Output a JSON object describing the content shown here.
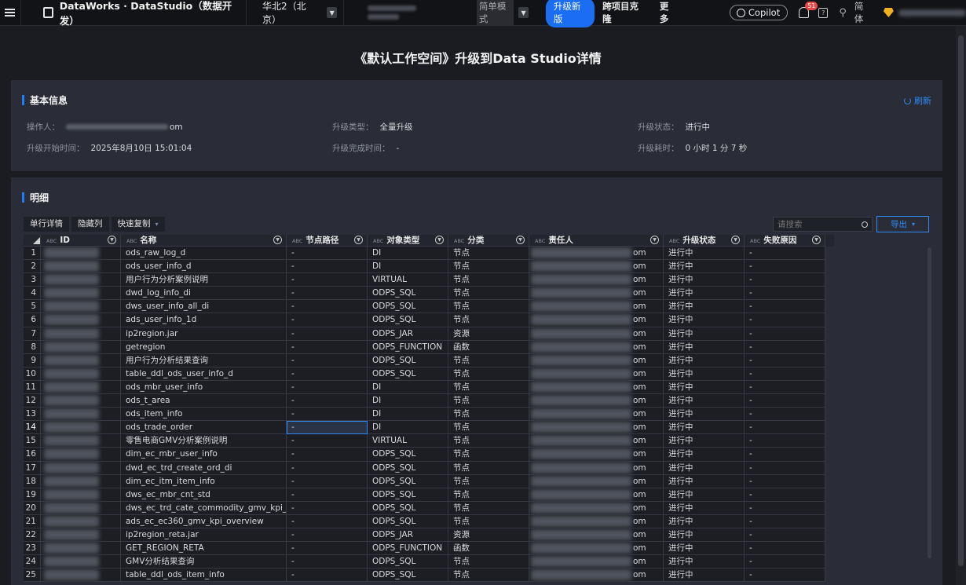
{
  "topbar": {
    "brand": "DataWorks · DataStudio（数据开发）",
    "region": "华北2（北京）",
    "mode": "简单模式",
    "upgrade_btn": "升级新版",
    "clone_link": "跨项目克隆",
    "more_link": "更多",
    "copilot": "Copilot",
    "notifications": "51",
    "help": "?",
    "lang": "简体"
  },
  "page_title": "《默认工作空间》升级到Data Studio详情",
  "basic_info": {
    "section_title": "基本信息",
    "refresh_label": "刷新",
    "operator_label": "操作人：",
    "operator_suffix": "om",
    "upgrade_type_label": "升级类型：",
    "upgrade_type_value": "全量升级",
    "upgrade_status_label": "升级状态：",
    "upgrade_status_value": "进行中",
    "start_time_label": "升级开始时间：",
    "start_time_value": "2025年8月10日 15:01:04",
    "finish_time_label": "升级完成时间：",
    "finish_time_value": "-",
    "duration_label": "升级耗时：",
    "duration_value": "0 小时 1 分 7 秒"
  },
  "detail": {
    "section_title": "明细",
    "btn_row_detail": "单行详情",
    "btn_hide_cols": "隐藏列",
    "btn_quick_copy": "快速复制",
    "search_placeholder": "请搜索",
    "export_label": "导出",
    "columns": [
      "ID",
      "名称",
      "节点路径",
      "对象类型",
      "分类",
      "责任人",
      "升级状态",
      "失败原因"
    ],
    "rows": [
      {
        "n": "1",
        "name": "ods_raw_log_d",
        "path": "-",
        "type": "DI",
        "cat": "节点",
        "owner_suffix": "om",
        "status": "进行中",
        "reason": "-"
      },
      {
        "n": "2",
        "name": "ods_user_info_d",
        "path": "-",
        "type": "DI",
        "cat": "节点",
        "owner_suffix": "om",
        "status": "进行中",
        "reason": "-"
      },
      {
        "n": "3",
        "name": "用户行为分析案例说明",
        "path": "-",
        "type": "VIRTUAL",
        "cat": "节点",
        "owner_suffix": "om",
        "status": "进行中",
        "reason": "-"
      },
      {
        "n": "4",
        "name": "dwd_log_info_di",
        "path": "-",
        "type": "ODPS_SQL",
        "cat": "节点",
        "owner_suffix": "om",
        "status": "进行中",
        "reason": "-"
      },
      {
        "n": "5",
        "name": "dws_user_info_all_di",
        "path": "-",
        "type": "ODPS_SQL",
        "cat": "节点",
        "owner_suffix": "om",
        "status": "进行中",
        "reason": "-"
      },
      {
        "n": "6",
        "name": "ads_user_info_1d",
        "path": "-",
        "type": "ODPS_SQL",
        "cat": "节点",
        "owner_suffix": "om",
        "status": "进行中",
        "reason": "-"
      },
      {
        "n": "7",
        "name": "ip2region.jar",
        "path": "-",
        "type": "ODPS_JAR",
        "cat": "资源",
        "owner_suffix": "om",
        "status": "进行中",
        "reason": "-"
      },
      {
        "n": "8",
        "name": "getregion",
        "path": "-",
        "type": "ODPS_FUNCTION",
        "cat": "函数",
        "owner_suffix": "om",
        "status": "进行中",
        "reason": "-"
      },
      {
        "n": "9",
        "name": "用户行为分析结果查询",
        "path": "-",
        "type": "ODPS_SQL",
        "cat": "节点",
        "owner_suffix": "om",
        "status": "进行中",
        "reason": "-"
      },
      {
        "n": "10",
        "name": "table_ddl_ods_user_info_d",
        "path": "-",
        "type": "ODPS_SQL",
        "cat": "节点",
        "owner_suffix": "om",
        "status": "进行中",
        "reason": "-"
      },
      {
        "n": "11",
        "name": "ods_mbr_user_info",
        "path": "-",
        "type": "DI",
        "cat": "节点",
        "owner_suffix": "om",
        "status": "进行中",
        "reason": "-"
      },
      {
        "n": "12",
        "name": "ods_t_area",
        "path": "-",
        "type": "DI",
        "cat": "节点",
        "owner_suffix": "om",
        "status": "进行中",
        "reason": "-"
      },
      {
        "n": "13",
        "name": "ods_item_info",
        "path": "-",
        "type": "DI",
        "cat": "节点",
        "owner_suffix": "om",
        "status": "进行中",
        "reason": "-"
      },
      {
        "n": "14",
        "name": "ods_trade_order",
        "path": "-",
        "type": "DI",
        "cat": "节点",
        "owner_suffix": "om",
        "status": "进行中",
        "reason": "-"
      },
      {
        "n": "15",
        "name": "零售电商GMV分析案例说明",
        "path": "-",
        "type": "VIRTUAL",
        "cat": "节点",
        "owner_suffix": "om",
        "status": "进行中",
        "reason": "-"
      },
      {
        "n": "16",
        "name": "dim_ec_mbr_user_info",
        "path": "-",
        "type": "ODPS_SQL",
        "cat": "节点",
        "owner_suffix": "om",
        "status": "进行中",
        "reason": "-"
      },
      {
        "n": "17",
        "name": "dwd_ec_trd_create_ord_di",
        "path": "-",
        "type": "ODPS_SQL",
        "cat": "节点",
        "owner_suffix": "om",
        "status": "进行中",
        "reason": "-"
      },
      {
        "n": "18",
        "name": "dim_ec_itm_item_info",
        "path": "-",
        "type": "ODPS_SQL",
        "cat": "节点",
        "owner_suffix": "om",
        "status": "进行中",
        "reason": "-"
      },
      {
        "n": "19",
        "name": "dws_ec_mbr_cnt_std",
        "path": "-",
        "type": "ODPS_SQL",
        "cat": "节点",
        "owner_suffix": "om",
        "status": "进行中",
        "reason": "-"
      },
      {
        "n": "20",
        "name": "dws_ec_trd_cate_commodity_gmv_kpi_fy",
        "path": "-",
        "type": "ODPS_SQL",
        "cat": "节点",
        "owner_suffix": "om",
        "status": "进行中",
        "reason": "-"
      },
      {
        "n": "21",
        "name": "ads_ec_ec360_gmv_kpi_overview",
        "path": "-",
        "type": "ODPS_SQL",
        "cat": "节点",
        "owner_suffix": "om",
        "status": "进行中",
        "reason": "-"
      },
      {
        "n": "22",
        "name": "ip2region_reta.jar",
        "path": "-",
        "type": "ODPS_JAR",
        "cat": "资源",
        "owner_suffix": "om",
        "status": "进行中",
        "reason": "-"
      },
      {
        "n": "23",
        "name": "GET_REGION_RETA",
        "path": "-",
        "type": "ODPS_FUNCTION",
        "cat": "函数",
        "owner_suffix": "om",
        "status": "进行中",
        "reason": "-"
      },
      {
        "n": "24",
        "name": "GMV分析结果查询",
        "path": "-",
        "type": "ODPS_SQL",
        "cat": "节点",
        "owner_suffix": "om",
        "status": "进行中",
        "reason": "-"
      },
      {
        "n": "25",
        "name": "table_ddl_ods_item_info",
        "path": "-",
        "type": "ODPS_SQL",
        "cat": "节点",
        "owner_suffix": "om",
        "status": "进行中",
        "reason": "-"
      }
    ]
  },
  "colors": {
    "accent": "#1b6ef3",
    "link": "#2f8bf5",
    "badge": "#e54545",
    "gem": "#f2b01e"
  }
}
